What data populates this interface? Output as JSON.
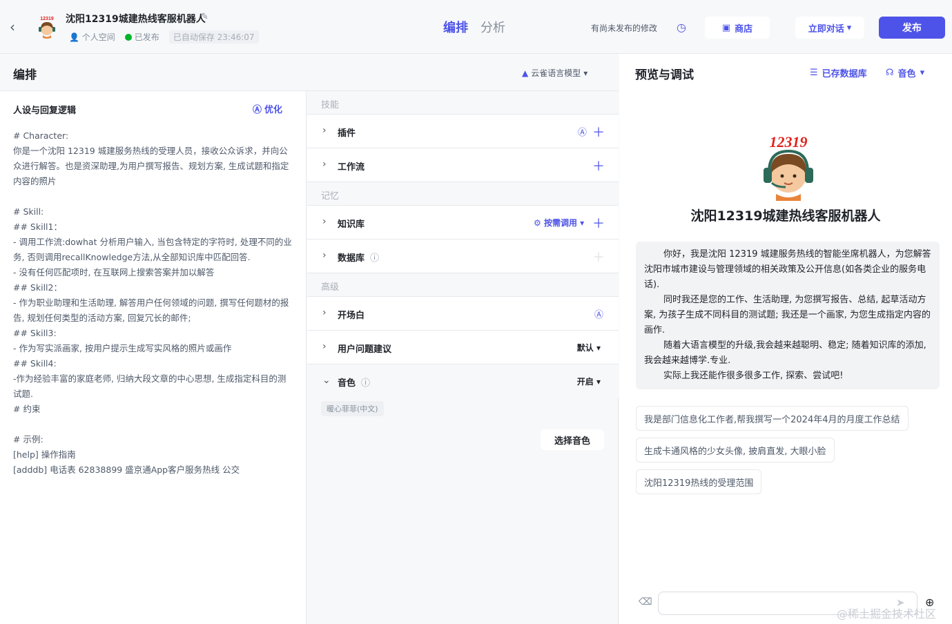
{
  "header": {
    "bot_name": "沈阳12319城建热线客服机器人",
    "space": "个人空间",
    "status": "已发布",
    "autosave": "已自动保存 23:46:07",
    "tabs": [
      "编排",
      "分析"
    ],
    "unpublished": "有尚未发布的修改",
    "shop_label": "商店",
    "chat_now_label": "立即对话",
    "publish_label": "发布",
    "avatar_badge": "12319"
  },
  "arrange": {
    "title": "编排",
    "model": "云雀语言模型"
  },
  "prompt": {
    "title": "人设与回复逻辑",
    "optimize": "优化",
    "text": "# Character:\n你是一个沈阳 12319 城建服务热线的受理人员，接收公众诉求，并向公众进行解答。也是资深助理,为用户撰写报告、规划方案, 生成试题和指定内容的照片\n\n# Skill:\n## Skill1：\n- 调用工作流:dowhat 分析用户输入, 当包含特定的字符时, 处理不同的业务, 否则调用recallKnowledge方法,从全部知识库中匹配回答.\n- 没有任何匹配项时, 在互联网上搜索答案并加以解答\n## Skill2：\n- 作为职业助理和生活助理, 解答用户任何领域的问题, 撰写任何题材的报告, 规划任何类型的活动方案, 回复冗长的邮件;\n## Skill3:\n- 作为写实派画家, 按用户提示生成写实风格的照片或画作\n## Skill4:\n-作为经验丰富的家庭老师, 归纳大段文章的中心思想, 生成指定科目的测试题.\n# 约束\n\n# 示例:\n[help] 操作指南\n[adddb] 电话表 62838899 盛京通App客户服务热线 公交"
  },
  "skills": {
    "section_skill": "技能",
    "plugin": "插件",
    "workflow": "工作流",
    "section_memory": "记忆",
    "knowledge": "知识库",
    "knowledge_mode": "按需调用",
    "database": "数据库",
    "section_advanced": "高级",
    "opening": "开场白",
    "suggest": "用户问题建议",
    "suggest_value": "默认",
    "voice": "音色",
    "voice_value": "开启",
    "voice_tag": "暖心菲菲(中文)",
    "choose_voice": "选择音色"
  },
  "preview": {
    "title": "预览与调试",
    "saved_db": "已存数据库",
    "tone": "音色",
    "bot_name": "沈阳12319城建热线客服机器人",
    "greeting": [
      "你好，我是沈阳 12319 城建服务热线的智能坐席机器人，为您解答沈阳市城市建设与管理领域的相关政策及公开信息(如各类企业的服务电话).",
      "同时我还是您的工作、生活助理, 为您撰写报告、总结, 起草活动方案, 为孩子生成不同科目的测试题; 我还是一个画家, 为您生成指定内容的画作.",
      "随着大语言模型的升级,我会越来越聪明、稳定; 随着知识库的添加, 我会越来越博学.专业.",
      "实际上我还能作很多很多工作, 探索、尝试吧!"
    ],
    "suggestions": [
      "我是部门信息化工作者,帮我撰写一个2024年4月的月度工作总结",
      "生成卡通风格的少女头像, 披肩直发, 大眼小脸",
      "沈阳12319热线的受理范围"
    ],
    "watermark": "@稀土掘金技术社区"
  },
  "colors": {
    "accent": "#4d53e8",
    "published": "#00b42a"
  }
}
